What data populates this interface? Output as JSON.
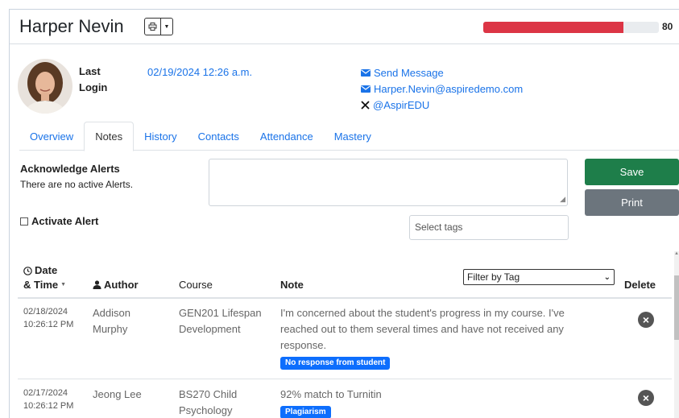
{
  "header": {
    "student_name": "Harper Nevin",
    "risk_score": "80",
    "risk_fraction": 0.8,
    "risk_color": "#dc3545"
  },
  "profile": {
    "last_login_label": "Last Login",
    "last_login_value": "02/19/2024 12:26 a.m.",
    "send_message": "Send Message",
    "email": "Harper.Nevin@aspiredemo.com",
    "twitter": "@AspirEDU"
  },
  "tabs": [
    {
      "label": "Overview",
      "active": false
    },
    {
      "label": "Notes",
      "active": true
    },
    {
      "label": "History",
      "active": false
    },
    {
      "label": "Contacts",
      "active": false
    },
    {
      "label": "Attendance",
      "active": false
    },
    {
      "label": "Mastery",
      "active": false
    }
  ],
  "notes_form": {
    "ack_title": "Acknowledge Alerts",
    "ack_text": "There are no active Alerts.",
    "save_label": "Save",
    "print_label": "Print",
    "activate_alert_label": "Activate Alert",
    "tags_placeholder": "Select tags",
    "save_color": "#1e7e4a",
    "print_color": "#6c757d"
  },
  "table": {
    "col_date_line1": "Date",
    "col_date_line2": "& Time",
    "col_author": "Author",
    "col_course": "Course",
    "col_note": "Note",
    "col_delete": "Delete",
    "filter_label": "Filter by Tag",
    "rows": [
      {
        "date": "02/18/2024",
        "time": "10:26:12 PM",
        "author_line1": "Addison",
        "author_line2": "Murphy",
        "course_line1": "GEN201 Lifespan",
        "course_line2": "Development",
        "note_line1": "I'm concerned about the student's progress in my course. I've",
        "note_line2": "reached out to them several times and have not received any",
        "note_line3": "response.",
        "tag": "No response from student"
      },
      {
        "date": "02/17/2024",
        "time": "10:26:12 PM",
        "author_line1": "Jeong Lee",
        "author_line2": "",
        "course_line1": "BS270 Child",
        "course_line2": "Psychology",
        "note_line1": "92% match to Turnitin",
        "note_line2": "",
        "note_line3": "",
        "tag": "Plagiarism"
      }
    ]
  },
  "icons": {
    "print": "printer-icon",
    "caret": "caret-down-icon",
    "envelope": "envelope-icon",
    "x_logo": "x-logo-icon",
    "clock": "clock-icon",
    "user": "user-icon",
    "delete": "times-circle-icon"
  }
}
